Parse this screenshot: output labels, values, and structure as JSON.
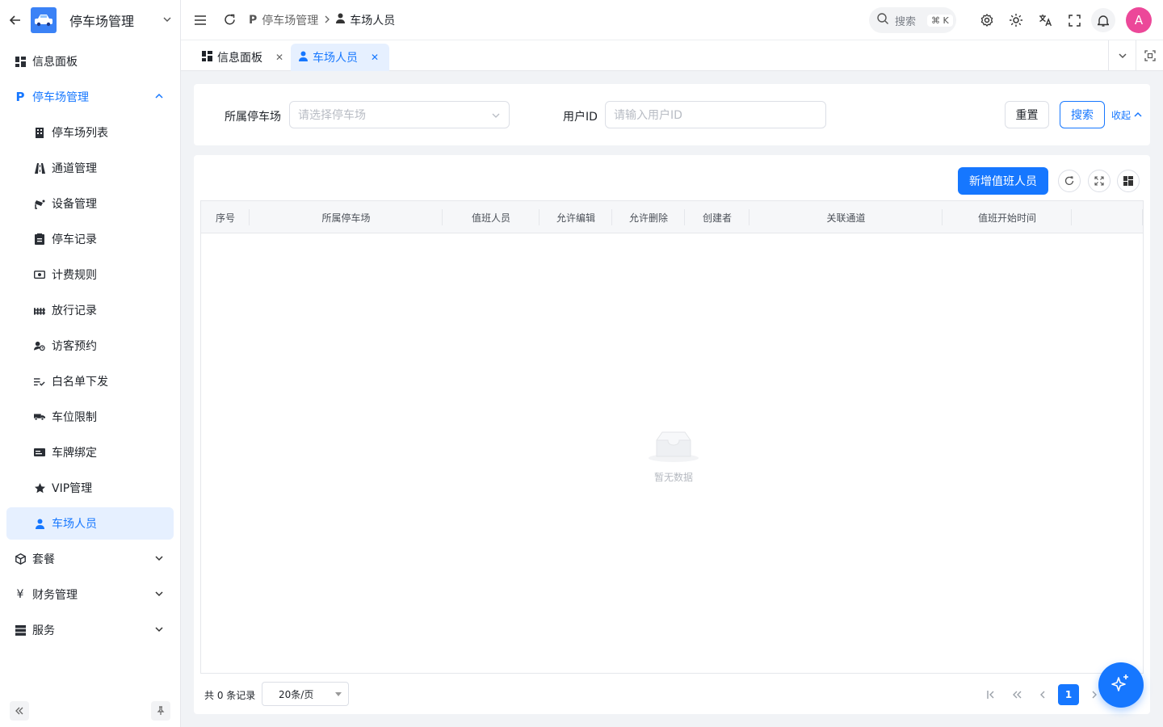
{
  "sidebar": {
    "title": "停车场管理",
    "items": [
      {
        "label": "信息面板",
        "icon": "dashboard-icon"
      },
      {
        "label": "停车场管理",
        "icon": "parking-icon"
      },
      {
        "label": "停车场列表",
        "icon": "building-icon"
      },
      {
        "label": "通道管理",
        "icon": "road-icon"
      },
      {
        "label": "设备管理",
        "icon": "camera-icon"
      },
      {
        "label": "停车记录",
        "icon": "clipboard-icon"
      },
      {
        "label": "计费规则",
        "icon": "money-icon"
      },
      {
        "label": "放行记录",
        "icon": "fence-icon"
      },
      {
        "label": "访客预约",
        "icon": "visitor-icon"
      },
      {
        "label": "白名单下发",
        "icon": "list-check-icon"
      },
      {
        "label": "车位限制",
        "icon": "truck-icon"
      },
      {
        "label": "车牌绑定",
        "icon": "card-icon"
      },
      {
        "label": "VIP管理",
        "icon": "star-icon"
      },
      {
        "label": "车场人员",
        "icon": "user-icon"
      },
      {
        "label": "套餐",
        "icon": "package-icon"
      },
      {
        "label": "财务管理",
        "icon": "yen-icon"
      },
      {
        "label": "服务",
        "icon": "server-icon"
      }
    ]
  },
  "header": {
    "breadcrumb": [
      "停车场管理",
      "车场人员"
    ],
    "search_placeholder": "搜索",
    "search_shortcut": "⌘ K",
    "avatar_letter": "A"
  },
  "tabs": [
    {
      "label": "信息面板"
    },
    {
      "label": "车场人员"
    }
  ],
  "filter": {
    "parking_label": "所属停车场",
    "parking_placeholder": "请选择停车场",
    "userid_label": "用户ID",
    "userid_placeholder": "请输入用户ID",
    "reset": "重置",
    "search": "搜索",
    "collapse": "收起"
  },
  "panel": {
    "add_button": "新增值班人员",
    "columns": [
      "序号",
      "所属停车场",
      "值班人员",
      "允许编辑",
      "允许删除",
      "创建者",
      "关联通道",
      "值班开始时间"
    ],
    "empty_text": "暂无数据",
    "total_text": "共 0 条记录",
    "page_size": "20条/页",
    "current_page": "1"
  },
  "colors": {
    "primary": "#1677ff",
    "active_bg": "#e6f0ff",
    "avatar": "#ec4899"
  }
}
